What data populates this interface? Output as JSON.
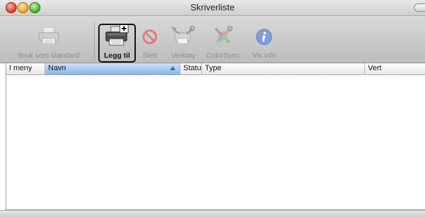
{
  "window": {
    "title": "Skriverliste"
  },
  "toolbar": {
    "items": [
      {
        "label": "Bruk som standard",
        "icon": "printer-default-icon",
        "enabled": false
      },
      {
        "label": "Legg til",
        "icon": "printer-add-icon",
        "enabled": true
      },
      {
        "label": "Slett",
        "icon": "delete-icon",
        "enabled": false
      },
      {
        "label": "Verktøy",
        "icon": "printer-utility-icon",
        "enabled": false
      },
      {
        "label": "ColorSync",
        "icon": "colorsync-icon",
        "enabled": false
      },
      {
        "label": "Vis info",
        "icon": "info-icon",
        "enabled": false
      }
    ]
  },
  "table": {
    "columns": [
      {
        "label": "I meny"
      },
      {
        "label": "Navn",
        "sorted": true
      },
      {
        "label": "Statu"
      },
      {
        "label": "Type"
      },
      {
        "label": "Vert"
      }
    ],
    "rows": []
  },
  "colors": {
    "sort_header": "#86b5ec",
    "accent_info": "#3a6fd0",
    "delete_red": "#e05a5a"
  }
}
